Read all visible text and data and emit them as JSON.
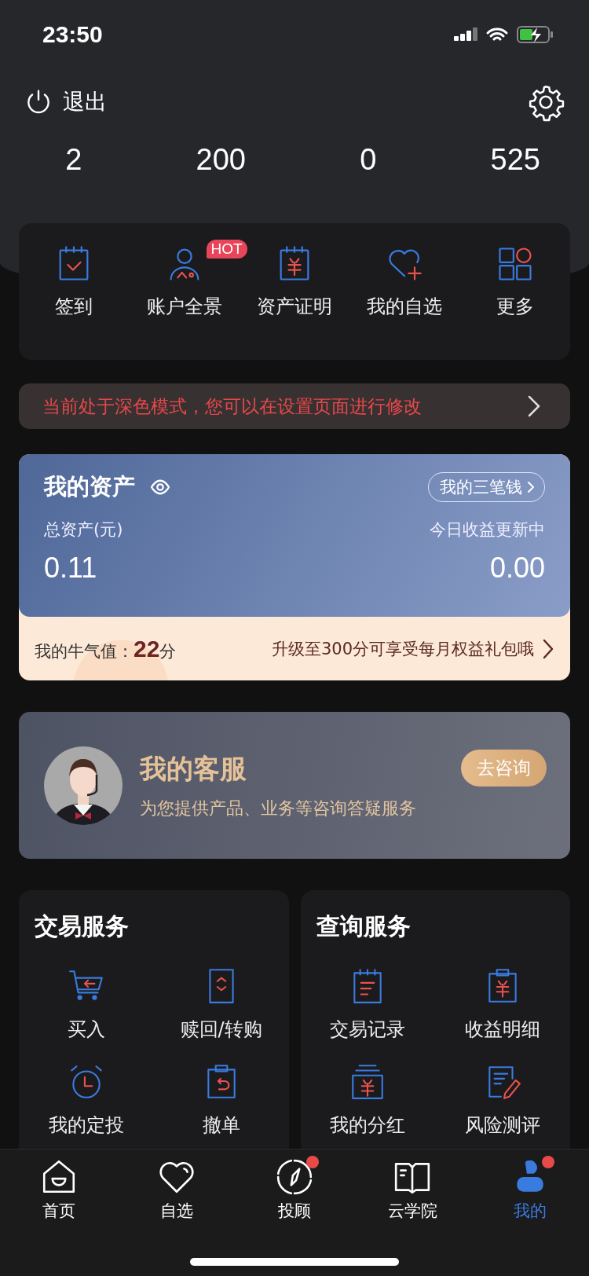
{
  "status_bar": {
    "time": "23:50"
  },
  "header": {
    "logout": "退出",
    "stats": [
      {
        "value": "2"
      },
      {
        "value": "200"
      },
      {
        "value": "0"
      },
      {
        "value": "525"
      }
    ]
  },
  "quick_menu": [
    {
      "label": "签到"
    },
    {
      "label": "账户全景",
      "badge": "HOT"
    },
    {
      "label": "资产证明"
    },
    {
      "label": "我的自选"
    },
    {
      "label": "更多"
    }
  ],
  "notice": {
    "text": "当前处于深色模式，您可以在设置页面进行修改"
  },
  "assets": {
    "title": "我的资产",
    "link": "我的三笔钱",
    "total_label": "总资产(元)",
    "total": "0.11",
    "today_label": "今日收益更新中",
    "today": "0.00",
    "bull_label": "我的牛气值：",
    "bull_value": "22",
    "bull_unit": "分",
    "upgrade": "升级至300分可享受每月权益礼包哦"
  },
  "customer_service": {
    "title": "我的客服",
    "subtitle": "为您提供产品、业务等咨询答疑服务",
    "button": "去咨询"
  },
  "panels": [
    {
      "title": "交易服务",
      "items": [
        {
          "label": "买入"
        },
        {
          "label": "赎回/转购"
        },
        {
          "label": "我的定投"
        },
        {
          "label": "撤单"
        }
      ]
    },
    {
      "title": "查询服务",
      "items": [
        {
          "label": "交易记录"
        },
        {
          "label": "收益明细"
        },
        {
          "label": "我的分红"
        },
        {
          "label": "风险测评"
        }
      ]
    }
  ],
  "tab_bar": [
    {
      "label": "首页",
      "selected": false,
      "dot": false
    },
    {
      "label": "自选",
      "selected": false,
      "dot": false
    },
    {
      "label": "投顾",
      "selected": false,
      "dot": true
    },
    {
      "label": "云学院",
      "selected": false,
      "dot": false
    },
    {
      "label": "我的",
      "selected": true,
      "dot": true
    }
  ]
}
